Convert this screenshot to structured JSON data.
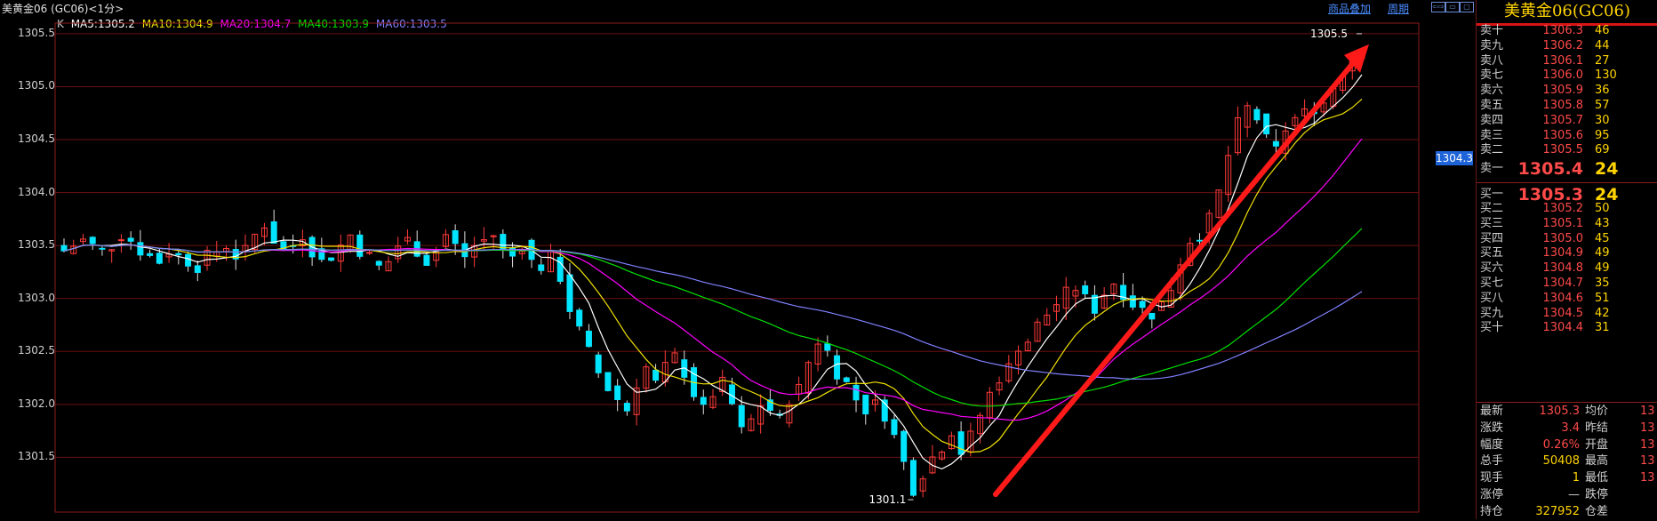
{
  "window": {
    "title": "美黄金06 (GC06)<1分>",
    "link_overlay": "商品叠加",
    "link_period": "周期",
    "win_buttons": [
      "⇦⇨",
      "▭",
      "▢"
    ]
  },
  "legend": {
    "k_label": "K",
    "items": [
      {
        "text": "MA5:1305.2",
        "color": "#ffffff"
      },
      {
        "text": "MA10:1304.9",
        "color": "#f0e000"
      },
      {
        "text": "MA20:1304.7",
        "color": "#ff00ff"
      },
      {
        "text": "MA40:1303.9",
        "color": "#00e000"
      },
      {
        "text": "MA60:1303.5",
        "color": "#8080ff"
      }
    ]
  },
  "price_tag": "1304.3",
  "chart_data": {
    "type": "candlestick",
    "y_ticks": [
      "1305.5",
      "1305.0",
      "1304.5",
      "1304.0",
      "1303.5",
      "1303.0",
      "1302.5",
      "1302.0",
      "1301.5"
    ],
    "ylim": [
      1301.05,
      1305.6
    ],
    "high_label": "1305.5",
    "low_label": "1301.1",
    "close_path": [
      1303.45,
      1303.5,
      1303.55,
      1303.5,
      1303.45,
      1303.5,
      1303.6,
      1303.55,
      1303.45,
      1303.4,
      1303.35,
      1303.45,
      1303.4,
      1303.35,
      1303.3,
      1303.4,
      1303.45,
      1303.5,
      1303.4,
      1303.45,
      1303.6,
      1303.7,
      1303.55,
      1303.45,
      1303.5,
      1303.6,
      1303.45,
      1303.35,
      1303.4,
      1303.5,
      1303.6,
      1303.45,
      1303.4,
      1303.3,
      1303.35,
      1303.5,
      1303.55,
      1303.45,
      1303.35,
      1303.45,
      1303.6,
      1303.5,
      1303.4,
      1303.5,
      1303.55,
      1303.6,
      1303.45,
      1303.4,
      1303.5,
      1303.35,
      1303.3,
      1303.4,
      1303.2,
      1302.9,
      1302.7,
      1302.5,
      1302.3,
      1302.15,
      1302.05,
      1301.95,
      1302.2,
      1302.35,
      1302.2,
      1302.35,
      1302.45,
      1302.3,
      1302.1,
      1301.95,
      1302.1,
      1302.2,
      1302.0,
      1301.75,
      1301.85,
      1302.0,
      1301.95,
      1301.85,
      1302.05,
      1302.15,
      1302.4,
      1302.6,
      1302.5,
      1302.3,
      1302.2,
      1302.05,
      1301.95,
      1302.0,
      1301.9,
      1301.7,
      1301.45,
      1301.2,
      1301.35,
      1301.5,
      1301.6,
      1301.75,
      1301.55,
      1301.7,
      1301.9,
      1302.1,
      1302.25,
      1302.35,
      1302.55,
      1302.6,
      1302.75,
      1302.85,
      1302.95,
      1303.05,
      1303.1,
      1303.0,
      1302.9,
      1303.05,
      1303.15,
      1303.05,
      1302.95,
      1302.9,
      1302.85,
      1302.95,
      1303.1,
      1303.35,
      1303.55,
      1303.6,
      1303.75,
      1304.0,
      1304.35,
      1304.65,
      1304.8,
      1304.7,
      1304.5,
      1304.4,
      1304.6,
      1304.7,
      1304.75,
      1304.8,
      1304.85,
      1305.0,
      1305.15,
      1305.3,
      1305.4
    ]
  },
  "quote": {
    "title": "美黄金06(GC06)",
    "asks": [
      {
        "label": "卖十",
        "price": "1306.3",
        "vol": "46"
      },
      {
        "label": "卖九",
        "price": "1306.2",
        "vol": "44"
      },
      {
        "label": "卖八",
        "price": "1306.1",
        "vol": "27"
      },
      {
        "label": "卖七",
        "price": "1306.0",
        "vol": "130"
      },
      {
        "label": "卖六",
        "price": "1305.9",
        "vol": "36"
      },
      {
        "label": "卖五",
        "price": "1305.8",
        "vol": "57"
      },
      {
        "label": "卖四",
        "price": "1305.7",
        "vol": "30"
      },
      {
        "label": "卖三",
        "price": "1305.6",
        "vol": "95"
      },
      {
        "label": "卖二",
        "price": "1305.5",
        "vol": "69"
      },
      {
        "label": "卖一",
        "price": "1305.4",
        "vol": "24"
      }
    ],
    "bids": [
      {
        "label": "买一",
        "price": "1305.3",
        "vol": "24"
      },
      {
        "label": "买二",
        "price": "1305.2",
        "vol": "50"
      },
      {
        "label": "买三",
        "price": "1305.1",
        "vol": "43"
      },
      {
        "label": "买四",
        "price": "1305.0",
        "vol": "45"
      },
      {
        "label": "买五",
        "price": "1304.9",
        "vol": "49"
      },
      {
        "label": "买六",
        "price": "1304.8",
        "vol": "49"
      },
      {
        "label": "买七",
        "price": "1304.7",
        "vol": "35"
      },
      {
        "label": "买八",
        "price": "1304.6",
        "vol": "51"
      },
      {
        "label": "买九",
        "price": "1304.5",
        "vol": "42"
      },
      {
        "label": "买十",
        "price": "1304.4",
        "vol": "31"
      }
    ],
    "stats": [
      {
        "l1": "最新",
        "v1": "1305.3",
        "c1": "#ff4a4a",
        "l2": "均价",
        "v2": "13"
      },
      {
        "l1": "涨跌",
        "v1": "3.4",
        "c1": "#ff4a4a",
        "l2": "昨结",
        "v2": "13"
      },
      {
        "l1": "幅度",
        "v1": "0.26%",
        "c1": "#ff4a4a",
        "l2": "开盘",
        "v2": "13"
      },
      {
        "l1": "总手",
        "v1": "50408",
        "c1": "#ffd400",
        "l2": "最高",
        "v2": "13"
      },
      {
        "l1": "现手",
        "v1": "1",
        "c1": "#ffd400",
        "l2": "最低",
        "v2": "13"
      },
      {
        "l1": "涨停",
        "v1": "—",
        "c1": "#d0d0d0",
        "l2": "跌停",
        "v2": ""
      },
      {
        "l1": "持仓",
        "v1": "327952",
        "c1": "#ffd400",
        "l2": "仓差",
        "v2": ""
      }
    ]
  }
}
